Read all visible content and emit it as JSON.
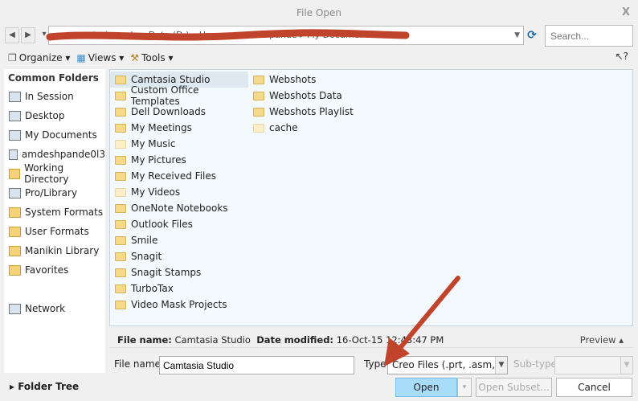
{
  "window": {
    "title": "File Open",
    "close": "X"
  },
  "nav": {
    "back": "◀",
    "forward": "▶",
    "history": "▾",
    "address_crumbs": "▸ amdeshpande ▸ Data (D:) ▸ Users ▸ amdeshpande ▸ My Documents",
    "refresh": "⟳",
    "search_placeholder": "Search..."
  },
  "toolbar": {
    "organize": "Organize",
    "views": "Views",
    "tools": "Tools",
    "help": "?"
  },
  "sidebar": {
    "heading": "Common Folders",
    "items": [
      {
        "label": "In Session",
        "icon": "monitor-icon"
      },
      {
        "label": "Desktop",
        "icon": "desktop-icon"
      },
      {
        "label": "My Documents",
        "icon": "documents-icon"
      },
      {
        "label": "amdeshpande0l3",
        "icon": "computer-icon"
      },
      {
        "label": "Working Directory",
        "icon": "folder-icon"
      },
      {
        "label": "Pro/Library",
        "icon": "library-icon"
      },
      {
        "label": "System Formats",
        "icon": "folder-icon"
      },
      {
        "label": "User Formats",
        "icon": "folder-icon"
      },
      {
        "label": "Manikin Library",
        "icon": "folder-icon"
      },
      {
        "label": "Favorites",
        "icon": "favorites-icon"
      },
      {
        "label": "Network",
        "icon": "network-icon"
      }
    ]
  },
  "files": {
    "col1": [
      "Camtasia Studio",
      "Custom Office Templates",
      "Dell Downloads",
      "My Meetings",
      "My Music",
      "My Pictures",
      "My Received Files",
      "My Videos",
      "OneNote Notebooks",
      "Outlook Files",
      "Smile",
      "Snagit",
      "Snagit Stamps",
      "TurboTax",
      "Video Mask Projects"
    ],
    "col2": [
      "Webshots",
      "Webshots Data",
      "Webshots Playlist",
      "cache"
    ],
    "selected": "Camtasia Studio"
  },
  "info": {
    "file_name_label": "File name:",
    "file_name": "Camtasia Studio",
    "date_label": "Date modified:",
    "date": "16-Oct-15 12:43:47 PM",
    "preview": "Preview ▴"
  },
  "form": {
    "file_name_label": "File name:",
    "file_name": "Camtasia Studio",
    "type_label": "Type",
    "type": "Creo Files (.prt, .asm, .drw, ...)",
    "subtype_label": "Sub-type"
  },
  "footer": {
    "folder_tree": "▸ Folder Tree",
    "open": "Open",
    "open_dd": "▾",
    "open_subset": "Open Subset...",
    "cancel": "Cancel"
  },
  "colors": {
    "annotation": "#c0432b",
    "open_button": "#a8dcf8"
  }
}
